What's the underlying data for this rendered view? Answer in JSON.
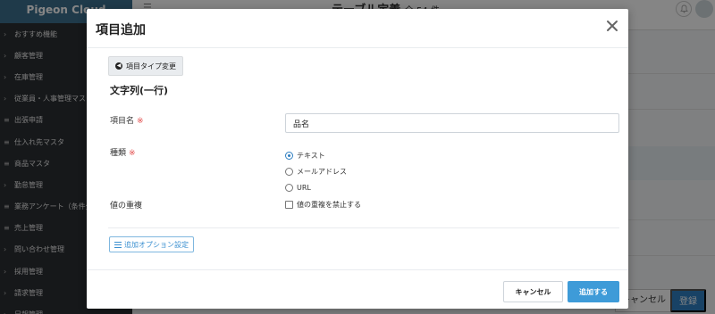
{
  "app": {
    "brand": "Pigeon Cloud",
    "page_title": "テーブル定義",
    "page_count": "全 54 件"
  },
  "sidebar": {
    "items": [
      {
        "icon": "chevron-right-icon",
        "label": "おすすめ機能"
      },
      {
        "icon": "chevron-right-icon",
        "label": "顧客管理"
      },
      {
        "icon": "chevron-right-icon",
        "label": "在庫管理"
      },
      {
        "icon": "chevron-right-icon",
        "label": "従業員・人事管理マスタ"
      },
      {
        "icon": "list-icon",
        "label": "出張申請"
      },
      {
        "icon": "list-icon",
        "label": "仕入れ先マスタ"
      },
      {
        "icon": "list-icon",
        "label": "商品マスタ"
      },
      {
        "icon": "chevron-right-icon",
        "label": "勤怠管理"
      },
      {
        "icon": "list-icon",
        "label": "業務アンケート（条件分岐）"
      },
      {
        "icon": "list-icon",
        "label": "売上管理"
      },
      {
        "icon": "chevron-right-icon",
        "label": "問い合わせ管理"
      },
      {
        "icon": "chevron-right-icon",
        "label": "採用管理"
      },
      {
        "icon": "chevron-right-icon",
        "label": "請求管理"
      },
      {
        "icon": "chevron-right-icon",
        "label": "日報管理"
      }
    ]
  },
  "background_footer": {
    "cancel_label": "キャンセル",
    "register_label": "登録"
  },
  "modal": {
    "title": "項目追加",
    "type_change_label": "項目タイプ変更",
    "section_title": "文字列(一行)",
    "fields": {
      "name_label": "項目名",
      "name_value": "品名",
      "kind_label": "種類",
      "duplicate_label": "値の重複",
      "required_mark": "※"
    },
    "kind_options": [
      {
        "label": "テキスト",
        "selected": true
      },
      {
        "label": "メールアドレス",
        "selected": false
      },
      {
        "label": "URL",
        "selected": false
      }
    ],
    "duplicate_checkbox_label": "値の重複を禁止する",
    "option_button_label": "追加オプション設定",
    "cancel_label": "キャンセル",
    "submit_label": "追加する"
  },
  "colors": {
    "primary": "#3e9bd8",
    "required": "#e24c4b",
    "sidebar_bg": "#2b2f33",
    "brand_bg": "#3c6f8f"
  }
}
